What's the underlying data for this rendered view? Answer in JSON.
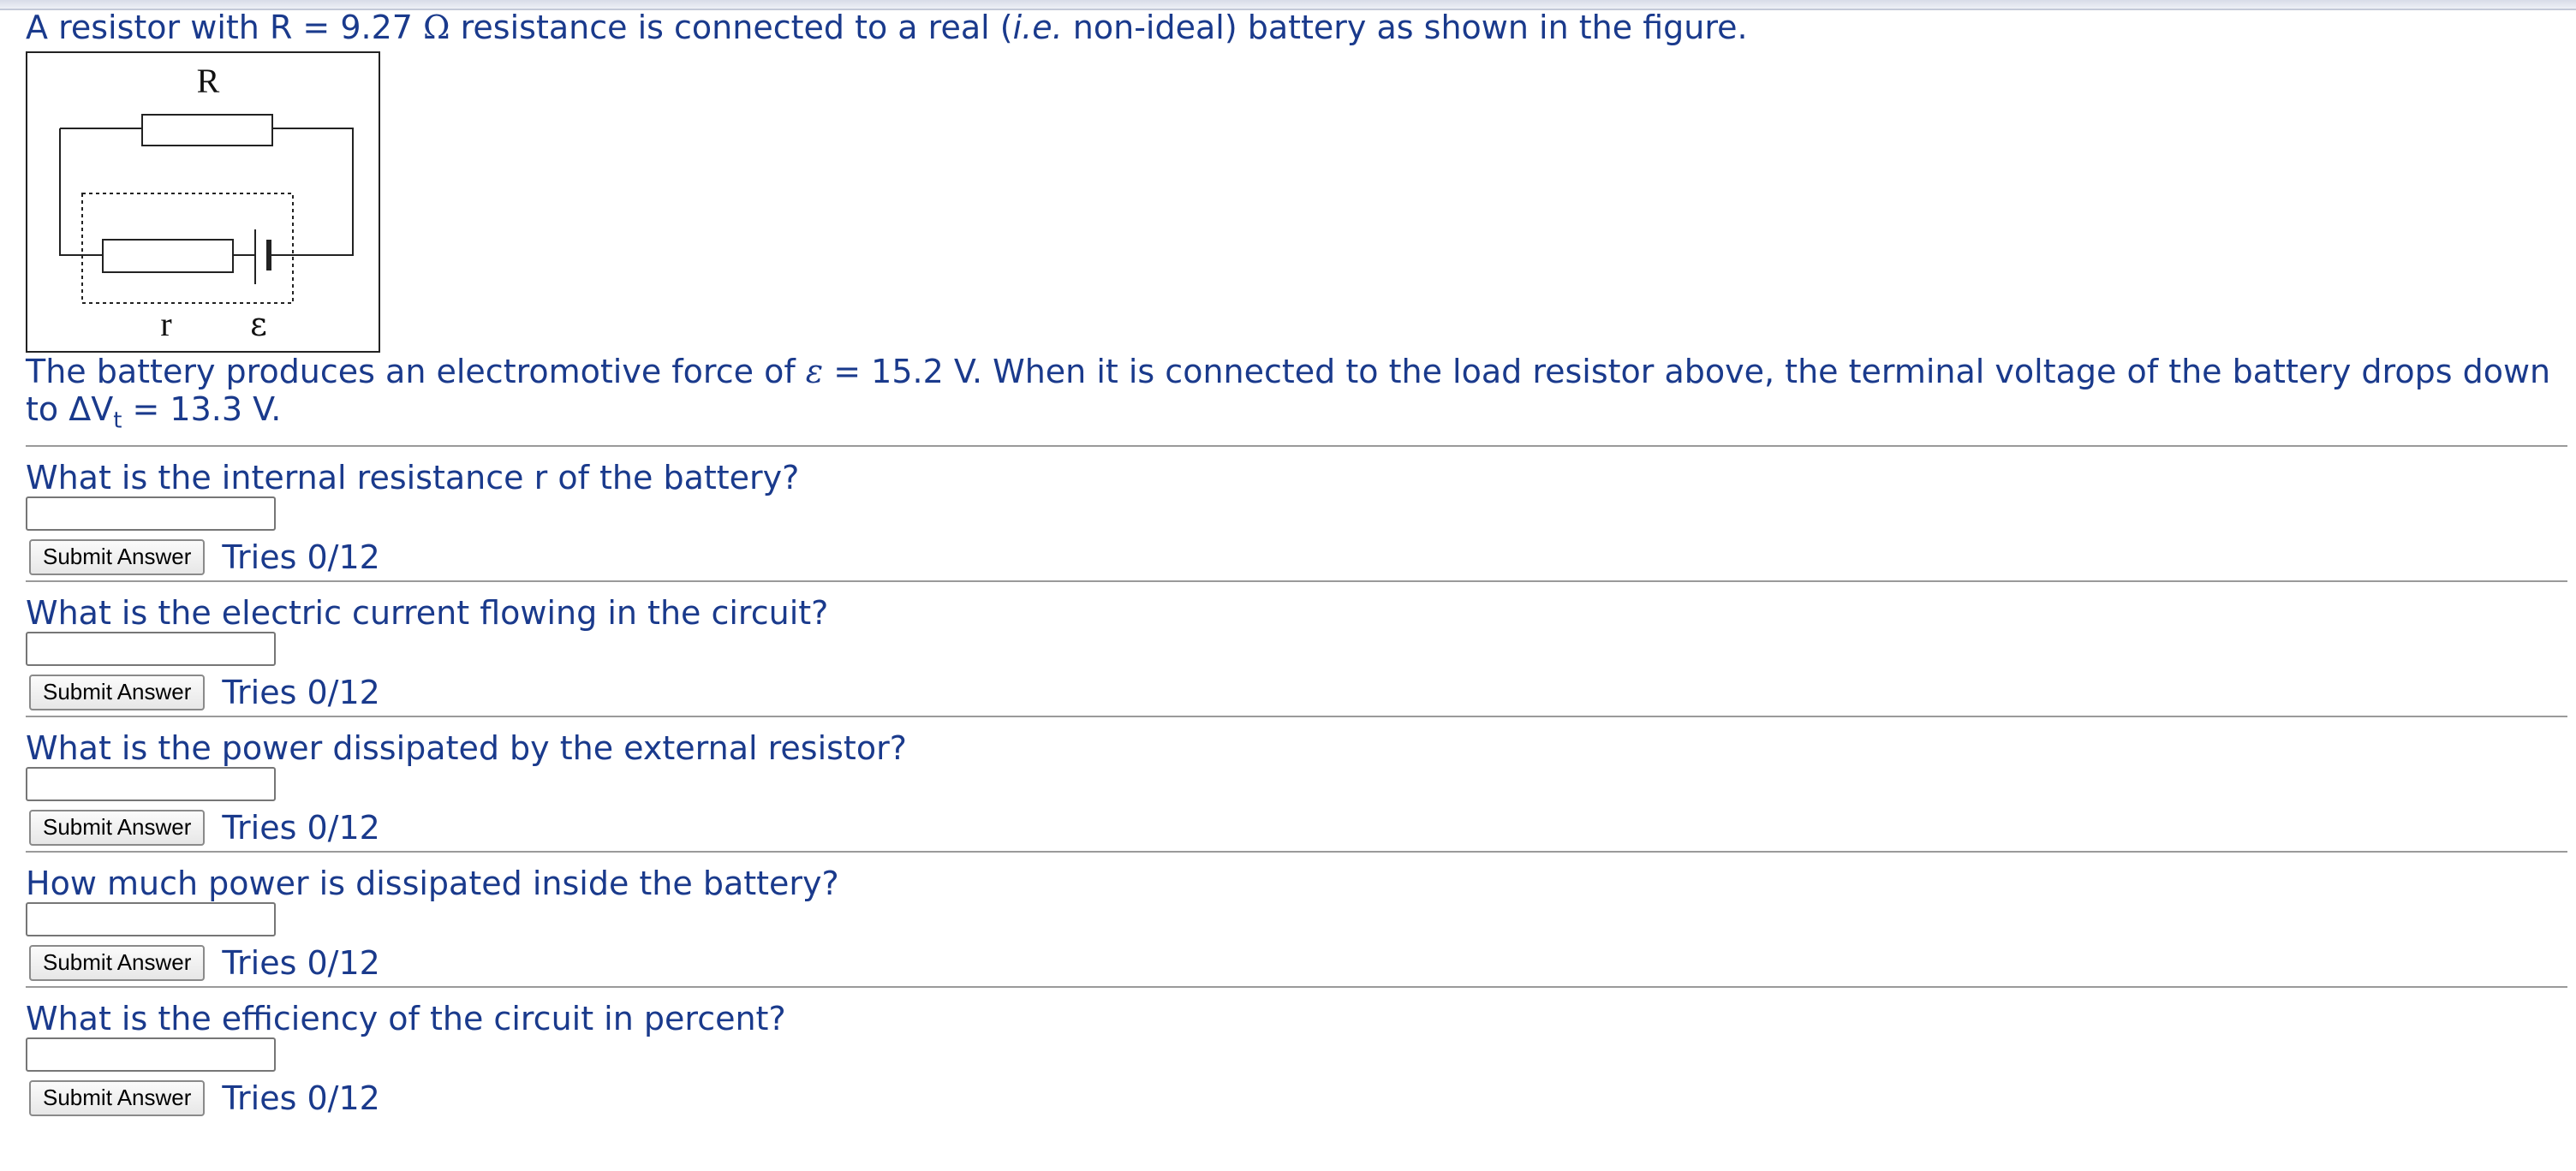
{
  "intro": {
    "prefix": "A resistor with R = 9.27 ",
    "omega": "Ω",
    "middle": " resistance is connected to a real (",
    "ie": "i.e.",
    "suffix": " non-ideal) battery as shown in the figure."
  },
  "figure": {
    "label_R": "R",
    "label_r": "r",
    "label_emf": "ε"
  },
  "description": {
    "part1": "The battery produces an electromotive force of ",
    "emf_symbol": "ε",
    "part2": " = 15.2 V. When it is connected to the load resistor above, the terminal voltage of the battery drops down to ΔV",
    "sub": "t",
    "part3": " = 13.3 V."
  },
  "parts": [
    {
      "question": "What is the internal resistance r of the battery?",
      "value": "",
      "button": "Submit Answer",
      "tries": "Tries 0/12"
    },
    {
      "question": "What is the electric current flowing in the circuit?",
      "value": "",
      "button": "Submit Answer",
      "tries": "Tries 0/12"
    },
    {
      "question": "What is the power dissipated by the external resistor?",
      "value": "",
      "button": "Submit Answer",
      "tries": "Tries 0/12"
    },
    {
      "question": "How much power is dissipated inside the battery?",
      "value": "",
      "button": "Submit Answer",
      "tries": "Tries 0/12"
    },
    {
      "question": "What is the efficiency of the circuit in percent?",
      "value": "",
      "button": "Submit Answer",
      "tries": "Tries 0/12"
    }
  ]
}
